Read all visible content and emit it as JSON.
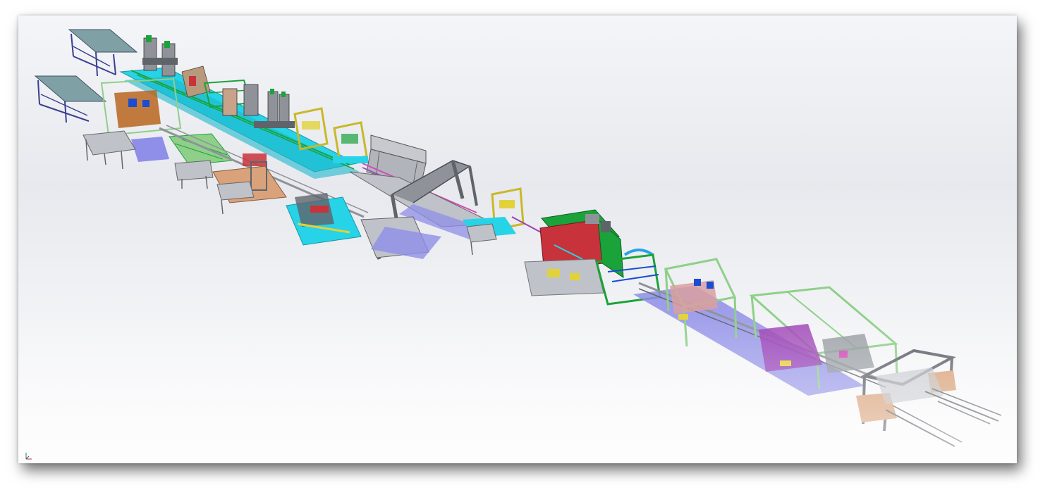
{
  "viewport": {
    "background_top": "#e7e9ee",
    "background_bottom": "#fbfbfc",
    "frame_shadow": "rgba(0,0,0,0.55)"
  },
  "model": {
    "palette": {
      "steel": "#8f9399",
      "dark_steel": "#5f646b",
      "cyan": "#27d3e6",
      "navy": "#3a3f8f",
      "lavender": "#8f8ee8",
      "green": "#1aa33a",
      "light_green": "#8fcf8a",
      "red": "#c8323a",
      "yellow": "#e2d23a",
      "tan": "#d9a27a",
      "brown": "#b8651e",
      "purple": "#9c3fb5",
      "pink": "#d24bb7"
    }
  },
  "icons": {
    "reference_triad": "axis-triad-icon"
  }
}
